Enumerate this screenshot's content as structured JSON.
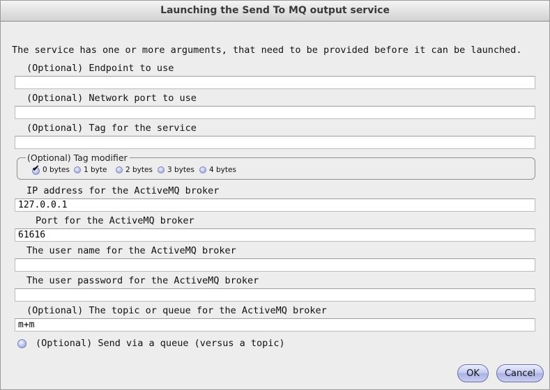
{
  "window": {
    "title": "Launching the Send To MQ output service"
  },
  "intro": "The service has one or more arguments, that need to be provided before it can be launched.",
  "fields": [
    {
      "label": "(Optional) Endpoint to use",
      "value": ""
    },
    {
      "label": "(Optional) Network port to use",
      "value": ""
    },
    {
      "label": "(Optional) Tag for the service",
      "value": ""
    },
    {
      "label": "IP address for the ActiveMQ broker",
      "value": "127.0.0.1"
    },
    {
      "label": "Port for the ActiveMQ broker",
      "value": "61616"
    },
    {
      "label": "The user name for the ActiveMQ broker",
      "value": ""
    },
    {
      "label": "The user password for the ActiveMQ broker",
      "value": ""
    },
    {
      "label": "(Optional) The topic or queue for the ActiveMQ broker",
      "value": "m+m"
    }
  ],
  "tag_modifier": {
    "title": "(Optional) Tag modifier",
    "options": [
      "0 bytes",
      "1 byte",
      "2 bytes",
      "3 bytes",
      "4 bytes"
    ],
    "selected": "0 bytes"
  },
  "queue_option": {
    "label": "(Optional) Send via a queue (versus a topic)",
    "checked": false
  },
  "buttons": {
    "ok": "OK",
    "cancel": "Cancel"
  },
  "colors": {
    "accent": "#b6bde6",
    "titlebar": "#d2d2d2",
    "background": "#ededed"
  }
}
